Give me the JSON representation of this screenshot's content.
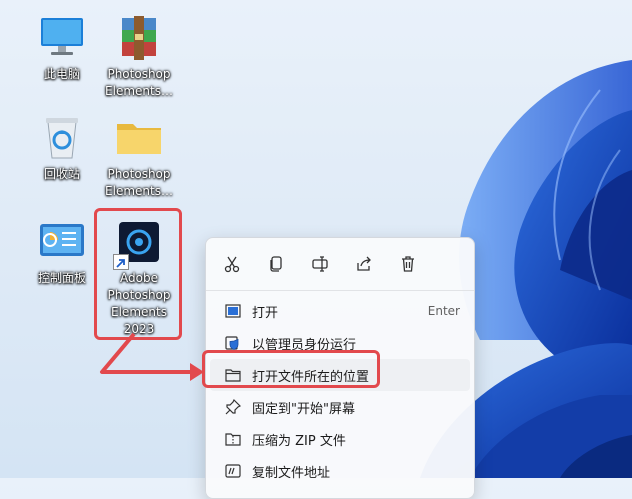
{
  "desktop": {
    "icons": [
      {
        "label": "此电脑",
        "icon": "computer-icon"
      },
      {
        "label": "Photoshop\nElements…",
        "icon": "winrar-archive-icon"
      },
      {
        "label": "回收站",
        "icon": "recycle-bin-icon"
      },
      {
        "label": "Photoshop\nElements…",
        "icon": "folder-icon"
      },
      {
        "label": "控制面板",
        "icon": "control-panel-icon"
      },
      {
        "label": "Adobe\nPhotoshop\nElements\n2023",
        "icon": "photoshop-elements-shortcut-icon"
      }
    ]
  },
  "context_menu": {
    "quick_actions": [
      "cut-icon",
      "copy-icon",
      "rename-icon",
      "share-icon",
      "delete-icon"
    ],
    "items": [
      {
        "label": "打开",
        "accelerator": "Enter",
        "icon": "open-icon"
      },
      {
        "label": "以管理员身份运行",
        "accelerator": "",
        "icon": "shield-icon"
      },
      {
        "label": "打开文件所在的位置",
        "accelerator": "",
        "icon": "folder-open-icon"
      },
      {
        "label": "固定到\"开始\"屏幕",
        "accelerator": "",
        "icon": "pin-icon"
      },
      {
        "label": "压缩为 ZIP 文件",
        "accelerator": "",
        "icon": "zip-icon"
      },
      {
        "label": "复制文件地址",
        "accelerator": "",
        "icon": "copy-path-icon"
      }
    ]
  },
  "colors": {
    "annotation_red": "#e2494d",
    "accent_blue": "#0067c0"
  }
}
